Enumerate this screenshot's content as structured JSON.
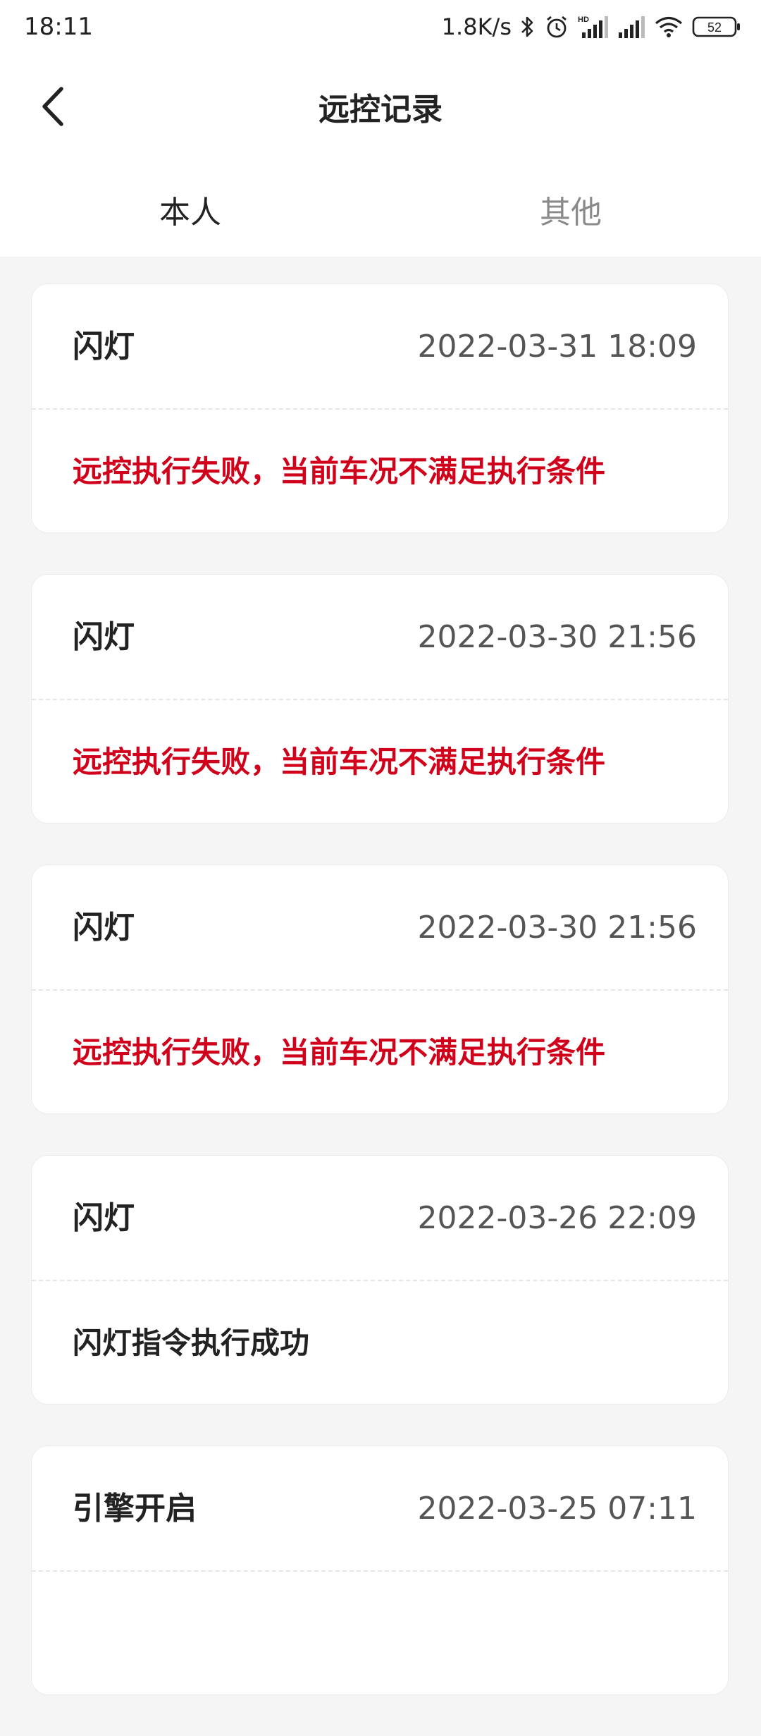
{
  "status_bar": {
    "time": "18:11",
    "net_speed": "1.8K/s",
    "battery": "52",
    "icons": [
      "bluetooth-icon",
      "alarm-icon",
      "signal-hd-icon",
      "signal-icon",
      "wifi-icon",
      "battery-icon"
    ]
  },
  "header": {
    "back_icon": "chevron-left-icon",
    "title": "远控记录"
  },
  "tabs": [
    {
      "label": "本人",
      "active": true
    },
    {
      "label": "其他",
      "active": false
    }
  ],
  "colors": {
    "fail": "#d0021b",
    "text": "#222222",
    "time": "#555555",
    "background": "#f5f5f5"
  },
  "records": [
    {
      "action": "闪灯",
      "time": "2022-03-31 18:09",
      "message": "远控执行失败，当前车况不满足执行条件",
      "status": "fail"
    },
    {
      "action": "闪灯",
      "time": "2022-03-30 21:56",
      "message": "远控执行失败，当前车况不满足执行条件",
      "status": "fail"
    },
    {
      "action": "闪灯",
      "time": "2022-03-30 21:56",
      "message": "远控执行失败，当前车况不满足执行条件",
      "status": "fail"
    },
    {
      "action": "闪灯",
      "time": "2022-03-26 22:09",
      "message": "闪灯指令执行成功",
      "status": "ok"
    },
    {
      "action": "引擎开启",
      "time": "2022-03-25 07:11",
      "message": "",
      "status": "ok"
    }
  ]
}
